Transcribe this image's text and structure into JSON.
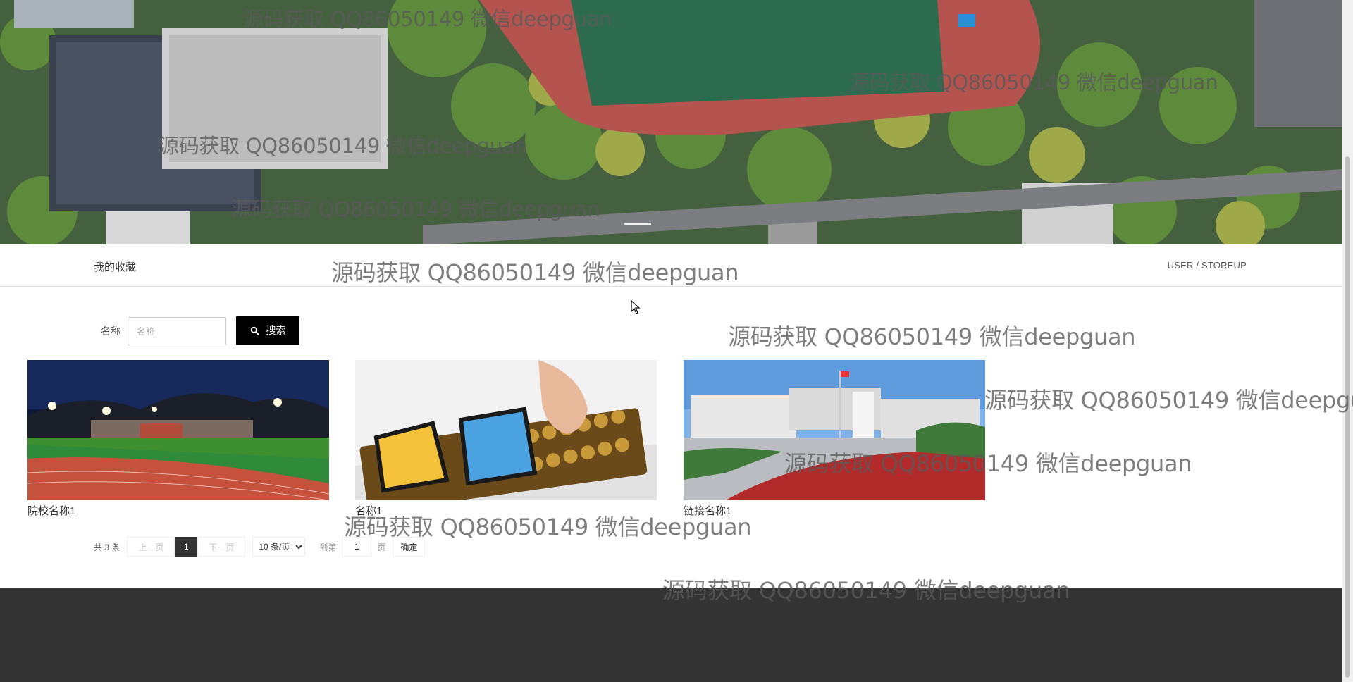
{
  "header": {
    "title": "我的收藏",
    "breadcrumb": "USER / STOREUP"
  },
  "search": {
    "label": "名称",
    "placeholder": "名称",
    "button_label": "搜索",
    "button_icon": "search-icon"
  },
  "cards": [
    {
      "name": "院校名称1",
      "image": "stadium-photo"
    },
    {
      "name": "名称1",
      "image": "accounting-abacus-photo"
    },
    {
      "name": "链接名称1",
      "image": "campus-building-photo"
    }
  ],
  "pagination": {
    "total": "共 3 条",
    "prev": "上一页",
    "current": "1",
    "next": "下一页",
    "page_size": "10 条/页",
    "page_size_options": [
      "10 条/页"
    ],
    "goto_label": "到第",
    "goto_value": "1",
    "page_unit": "页",
    "confirm": "确定"
  },
  "watermark": {
    "text": "源码获取 QQ86050149 微信deepguan"
  },
  "colors": {
    "search_button": "#000000",
    "footer": "#343434",
    "pager_current": "#333333"
  }
}
